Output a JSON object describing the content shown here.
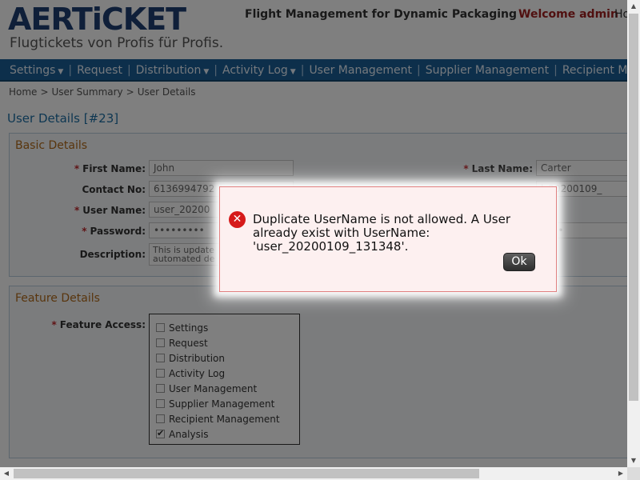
{
  "header": {
    "logo_main": "AERTiCKET",
    "logo_tagline": "Flugtickets von Profis für Profis.",
    "app_title": "Flight Management for Dynamic Packaging",
    "welcome": "Welcome admin",
    "home": "Ho"
  },
  "nav": {
    "items": [
      {
        "label": "Settings",
        "dropdown": true
      },
      {
        "label": "Request",
        "dropdown": false
      },
      {
        "label": "Distribution",
        "dropdown": true
      },
      {
        "label": "Activity Log",
        "dropdown": true
      },
      {
        "label": "User Management",
        "dropdown": false
      },
      {
        "label": "Supplier Management",
        "dropdown": false
      },
      {
        "label": "Recipient Management",
        "dropdown": false
      }
    ]
  },
  "breadcrumb": [
    "Home",
    ">",
    "User Summary",
    ">",
    "User Details"
  ],
  "page_title": "User Details [#23]",
  "basic": {
    "legend": "Basic Details",
    "first_name_label": "First Name:",
    "first_name_value": "John",
    "last_name_label": "Last Name:",
    "last_name_value": "Carter",
    "contact_label": "Contact No:",
    "contact_value": "6136994792",
    "email_value_partial": "l_20200109_",
    "username_label": "User Name:",
    "username_value": "user_20200",
    "password_label": "Password:",
    "password_value": "•••••••••",
    "confirm_password_partial": "••••",
    "description_label": "Description:",
    "description_line1": "This is update",
    "description_line2": "automated de"
  },
  "feature": {
    "legend": "Feature Details",
    "access_label": "Feature Access:",
    "items": [
      {
        "label": "Settings",
        "checked": false
      },
      {
        "label": "Request",
        "checked": false
      },
      {
        "label": "Distribution",
        "checked": false
      },
      {
        "label": "Activity Log",
        "checked": false
      },
      {
        "label": "User Management",
        "checked": false
      },
      {
        "label": "Supplier Management",
        "checked": false
      },
      {
        "label": "Recipient Management",
        "checked": false
      },
      {
        "label": "Analysis",
        "checked": true
      }
    ]
  },
  "dialog": {
    "message": "Duplicate UserName is not allowed. A User already exist with UserName: 'user_20200109_131348'.",
    "ok_label": "Ok",
    "icon": "error-icon"
  },
  "colors": {
    "nav_bg": "#1b5f96",
    "error_red": "#d61a1a",
    "legend_orange": "#b36b1a",
    "title_blue": "#1d6fa5",
    "welcome_red": "#a02020"
  }
}
